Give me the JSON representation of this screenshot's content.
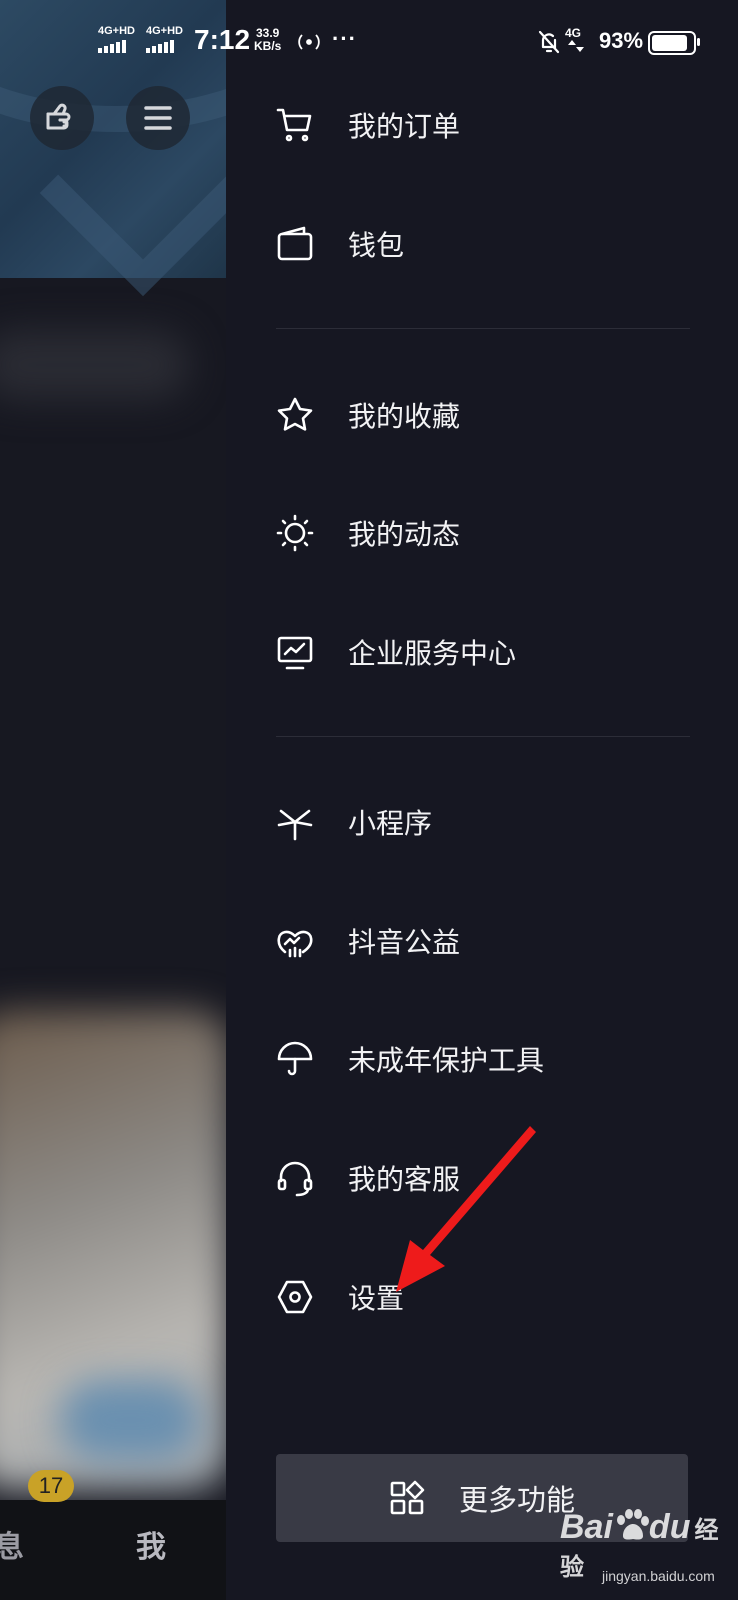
{
  "status_bar": {
    "sim1": "4G+HD",
    "sim2": "4G+HD",
    "time": "7:12",
    "speed_value": "33.9",
    "speed_unit": "KB/s",
    "more": "···",
    "network": "4G",
    "battery_percent": "93%",
    "battery_level": 0.93
  },
  "background": {
    "tab_message": "息",
    "tab_me": "我",
    "badge_count": "17"
  },
  "drawer": {
    "group1": [
      {
        "label": "我的订单",
        "icon": "cart-icon"
      },
      {
        "label": "钱包",
        "icon": "wallet-icon"
      }
    ],
    "group2": [
      {
        "label": "我的收藏",
        "icon": "star-icon"
      },
      {
        "label": "我的动态",
        "icon": "sun-icon"
      },
      {
        "label": "企业服务中心",
        "icon": "monitor-chart-icon"
      }
    ],
    "group3": [
      {
        "label": "小程序",
        "icon": "mini-program-icon"
      },
      {
        "label": "抖音公益",
        "icon": "heart-charity-icon"
      },
      {
        "label": "未成年保护工具",
        "icon": "umbrella-icon"
      },
      {
        "label": "我的客服",
        "icon": "headset-icon"
      },
      {
        "label": "设置",
        "icon": "settings-hexagon-icon"
      }
    ],
    "more_button": {
      "label": "更多功能",
      "icon": "grid-apps-icon"
    }
  },
  "annotation": {
    "arrow_color": "#ee1b1b"
  },
  "watermark": {
    "brand": "Bai",
    "brand2": "du",
    "suffix": "经验",
    "url": "jingyan.baidu.com"
  }
}
